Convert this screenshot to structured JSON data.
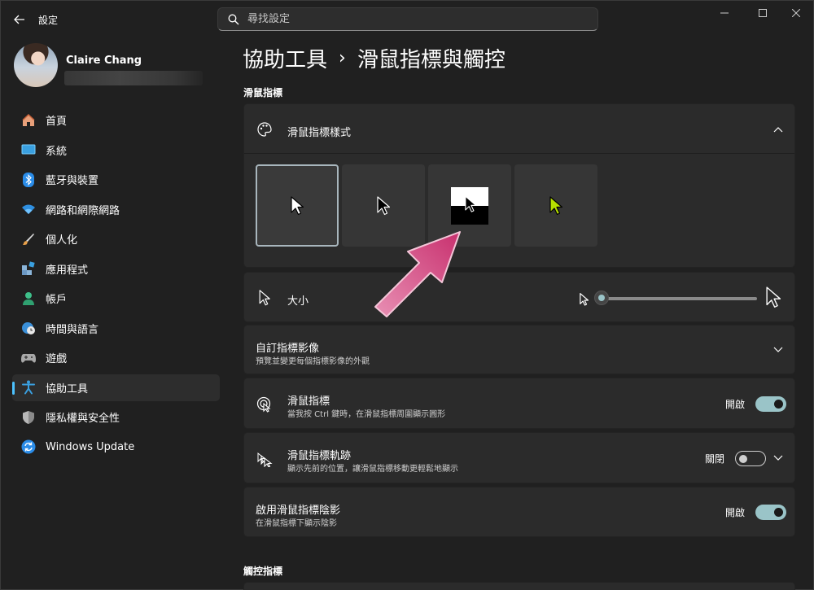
{
  "window": {
    "title": "設定"
  },
  "search": {
    "placeholder": "尋找設定"
  },
  "profile": {
    "name": "Claire Chang"
  },
  "nav": {
    "items": [
      {
        "label": "首頁",
        "icon": "home-icon"
      },
      {
        "label": "系統",
        "icon": "monitor-icon"
      },
      {
        "label": "藍牙與裝置",
        "icon": "bluetooth-icon"
      },
      {
        "label": "網路和網際網路",
        "icon": "wifi-icon"
      },
      {
        "label": "個人化",
        "icon": "brush-icon"
      },
      {
        "label": "應用程式",
        "icon": "apps-icon"
      },
      {
        "label": "帳戶",
        "icon": "person-icon"
      },
      {
        "label": "時間與語言",
        "icon": "globe-clock-icon"
      },
      {
        "label": "遊戲",
        "icon": "gamepad-icon"
      },
      {
        "label": "協助工具",
        "icon": "accessibility-icon",
        "active": true
      },
      {
        "label": "隱私權與安全性",
        "icon": "shield-icon"
      },
      {
        "label": "Windows Update",
        "icon": "update-icon"
      }
    ]
  },
  "breadcrumb": {
    "parent": "協助工具",
    "separator": "›",
    "current": "滑鼠指標與觸控"
  },
  "sections": {
    "pointer": "滑鼠指標",
    "touch": "觸控指標"
  },
  "pointer_style": {
    "title": "滑鼠指標樣式",
    "options": [
      "white",
      "black",
      "inverted",
      "custom"
    ],
    "selected_index": 0,
    "custom_color": "#b8e000"
  },
  "size": {
    "title": "大小",
    "value_fraction": 0.0
  },
  "custom_images": {
    "title": "自訂指標影像",
    "subtitle": "預覽並變更每個指標影像的外觀"
  },
  "mouse_indicator": {
    "title": "滑鼠指標",
    "subtitle": "當我按 Ctrl 鍵時，在滑鼠指標周圍顯示圓形",
    "state_label": "開啟",
    "on": true
  },
  "pointer_trails": {
    "title": "滑鼠指標軌跡",
    "subtitle": "顯示先前的位置，讓滑鼠指標移動更輕鬆地顯示",
    "state_label": "關閉",
    "on": false
  },
  "pointer_shadow": {
    "title": "啟用滑鼠指標陰影",
    "subtitle": "在滑鼠指標下顯示陰影",
    "state_label": "開啟",
    "on": true
  },
  "colors": {
    "accent": "#4cc2ff",
    "toggle_on": "#9ac4c8",
    "annotation_arrow": "#d0457c"
  }
}
